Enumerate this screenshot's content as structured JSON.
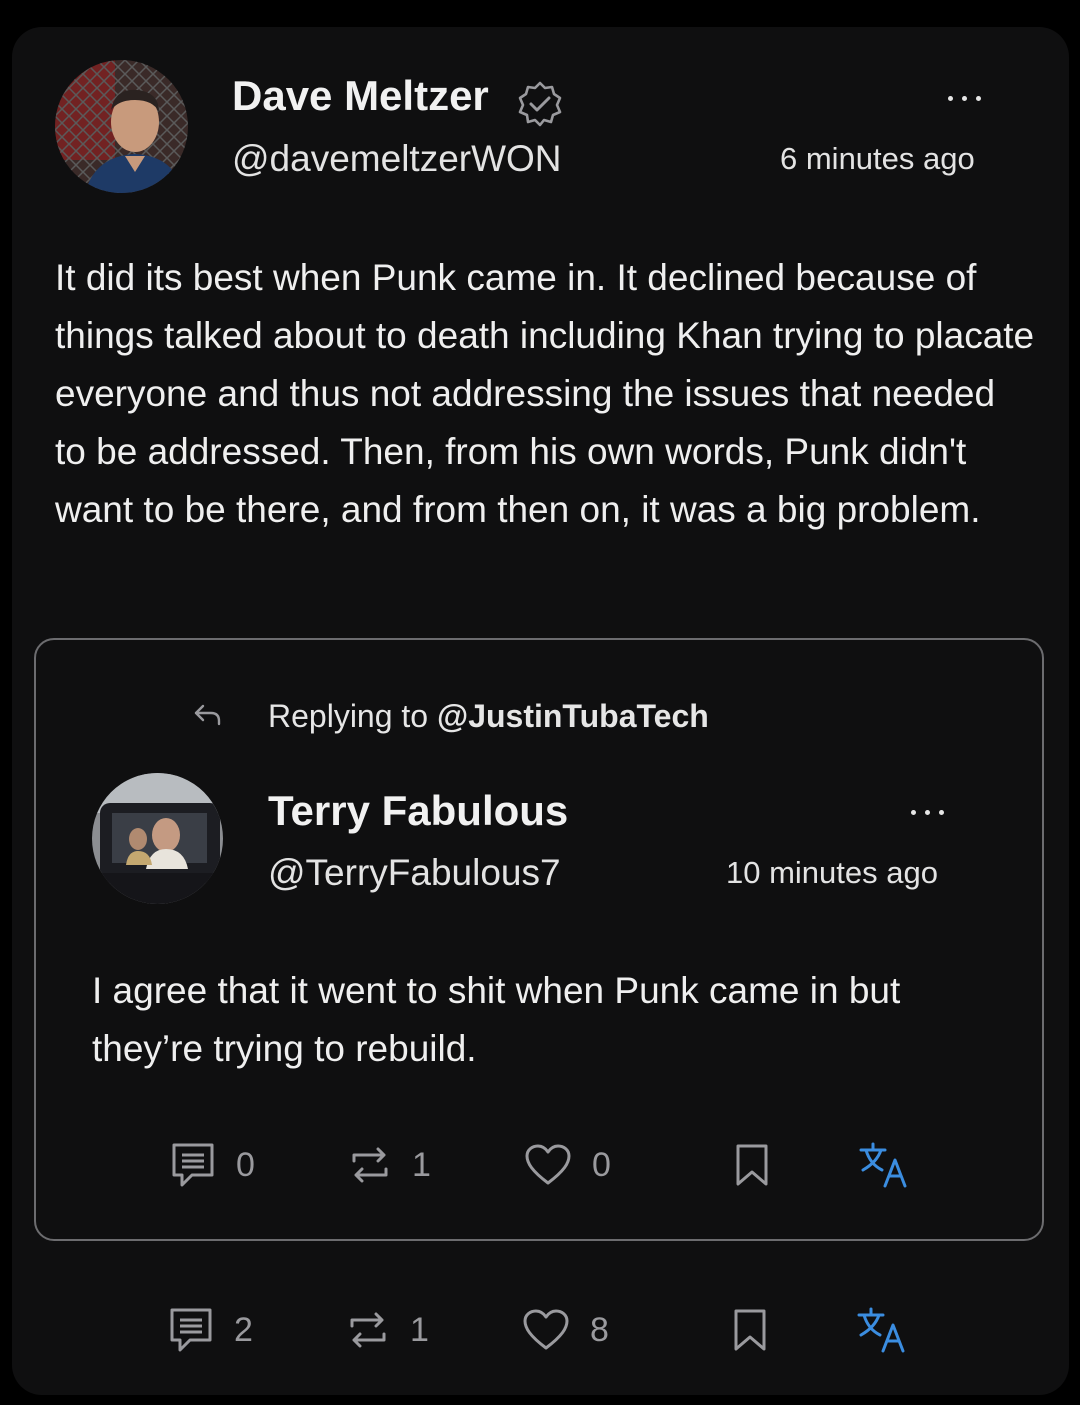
{
  "post": {
    "author_name": "Dave Meltzer",
    "author_handle": "@davemeltzerWON",
    "timestamp": "6 minutes ago",
    "body": "It did its best when Punk came in.  It declined because of things talked about to death including Khan trying to placate everyone and thus not addressing the issues that needed to be addressed.  Then, from his own words, Punk didn't want to be there, and from then on, it was a big problem.",
    "verified": true,
    "actions": {
      "comments": "2",
      "reposts": "1",
      "likes": "8"
    }
  },
  "quoted": {
    "replying_prefix": "Replying to ",
    "replying_handle": "@JustinTubaTech",
    "author_name": "Terry Fabulous",
    "author_handle": "@TerryFabulous7",
    "timestamp": "10 minutes ago",
    "body": "I agree that it went to shit when Punk came in but they’re trying to rebuild.",
    "actions": {
      "comments": "0",
      "reposts": "1",
      "likes": "0"
    }
  },
  "colors": {
    "background": "#0f0f10",
    "text": "#efefef",
    "muted": "#9a9a9e",
    "translate_accent": "#3b8de0",
    "border": "#6c6c6f"
  },
  "icons": [
    "more-dots-icon",
    "verified-badge-icon",
    "reply-arrow-icon",
    "comment-icon",
    "repost-icon",
    "heart-icon",
    "bookmark-icon",
    "translate-icon"
  ]
}
